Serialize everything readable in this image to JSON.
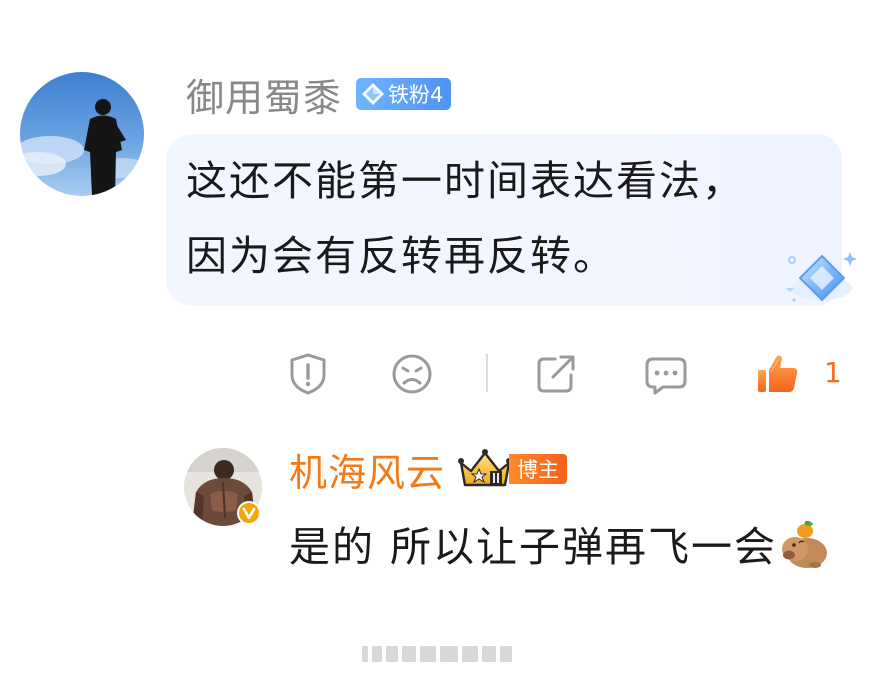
{
  "comment": {
    "author": "御用蜀黍",
    "fan_badge": "铁粉4",
    "text": "这还不能第一时间表达看法，因为会有反转再反转。"
  },
  "actions": {
    "report_icon": "warning-shield-icon",
    "dislike_icon": "sad-face-icon",
    "share_icon": "share-icon",
    "reply_icon": "comment-bubble-icon",
    "like_icon": "thumbs-up-icon",
    "like_count": "1"
  },
  "reply": {
    "author": "机海风云",
    "crown_level": "II",
    "role_badge": "博主",
    "text": "是的 所以让子弹再飞一会",
    "emoji": "capybara-orange-emoji"
  },
  "colors": {
    "author_gray": "#888888",
    "reply_orange": "#f27b18",
    "fan_badge_blue": "#4f93f5",
    "bubble_bg": "#f2f7ff",
    "like_orange": "#f2711c",
    "icon_gray": "#9a9a9a"
  }
}
